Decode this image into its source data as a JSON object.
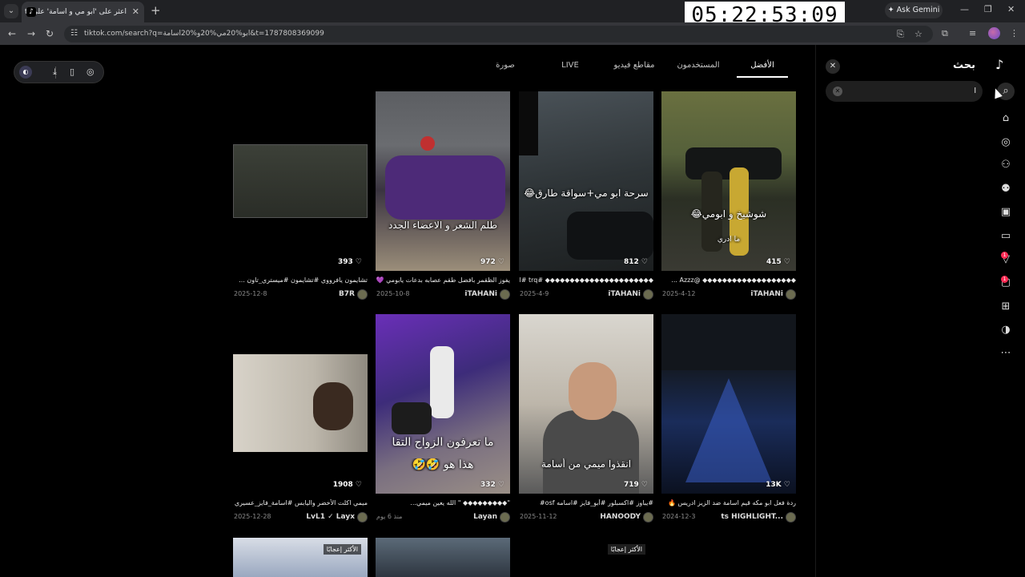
{
  "browser": {
    "tab_title": "اعثر على 'ابو مي و اسامة' على ti",
    "tab_favicon": "tiktok-icon",
    "ask_gemini": "Ask Gemini",
    "url": "tiktok.com/search?q=ابو%20مي%20و%20اسامة&t=1787808369099"
  },
  "overlay_clock": "05:22:53:09",
  "search_tabs": [
    "الأفضل",
    "المستخدمون",
    "مقاطع فيديو",
    "LIVE",
    "صورة"
  ],
  "side_panel": {
    "title": "بحث",
    "search_value": "ا"
  },
  "rail_badges": [
    "1",
    "1"
  ],
  "videos": [
    {
      "likes": "415",
      "overlay": "شوشيخ و ابومي😂",
      "overlay2": "ما ادري",
      "caption": "◆◆◆◆◆◆◆◆◆◆◆◆◆◆◆◆◆◆◆ @Azzz ...",
      "date": "2025-4-12",
      "author": "iTAHANi"
    },
    {
      "likes": "812",
      "overlay": "سرحة ابو مي+سواقة طارق😂",
      "overlay2": "",
      "caption": "◆◆◆◆◆◆◆◆◆◆◆◆◆◆◆◆◆◆◆◆◆◆ #trq #ابومي ...",
      "date": "2025-4-9",
      "author": "iTAHANi"
    },
    {
      "likes": "972",
      "overlay": "طلم الشعر و الاعضاء الجدد",
      "overlay2": "",
      "caption": "يفوز الظقمر بافضل طقم عصابه بدعات يابومي 💜 ...",
      "date": "2025-10-8",
      "author": "iTAHANi"
    },
    {
      "likes": "393",
      "overlay": "",
      "overlay2": "",
      "caption": "تشايمون يافرووي #تشايمون #ميستري_تاون ...",
      "date": "2025-12-8",
      "author": "B7R"
    },
    {
      "likes": "13K",
      "overlay": "",
      "overlay2": "",
      "caption": "ردة فعل ابو مكه قيم اسامة ضد الزيز ادريس 🔥",
      "date": "2024-12-3",
      "author": "ts HIGHLIGHT..."
    },
    {
      "likes": "719",
      "overlay": "انقذوا ميمي من أسامة",
      "overlay2": "",
      "caption": "#يباوز #اكسبلور #أبو_فايز #اسامه osf#",
      "date": "2025-11-12",
      "author": "HANOODY"
    },
    {
      "likes": "332",
      "overlay": "ما تعرفون الزواج التقا",
      "overlay2": "هذا هو 🤣🤣",
      "caption": "\"◆◆◆◆◆◆◆◆◆ \" الله يعين ميمي...",
      "date": "منذ 6 يوم",
      "author": "Layan"
    },
    {
      "likes": "1908",
      "overlay": "",
      "overlay2": "",
      "caption": "ميمي اكلت الأخضر واليابس #اسامة_فايز_عسيري ...",
      "date": "2025-12-28",
      "author": "LvL1 ✓ Layx"
    }
  ],
  "bottom_labels": [
    "الأكثر إعجابًا",
    "الأكثر إعجابًا"
  ],
  "colors": {
    "accent": "#fe2c55",
    "background": "#000000",
    "chrome_dark": "#202124",
    "chrome_bar": "#35363a"
  },
  "icons": [
    "tiktok-icon",
    "search-icon",
    "home-icon",
    "compass-icon",
    "follow-icon",
    "friends-icon",
    "live-icon",
    "tv-icon",
    "inbox-icon",
    "message-icon",
    "upload-icon",
    "profile-icon",
    "more-icon",
    "heart-icon",
    "close-icon"
  ]
}
